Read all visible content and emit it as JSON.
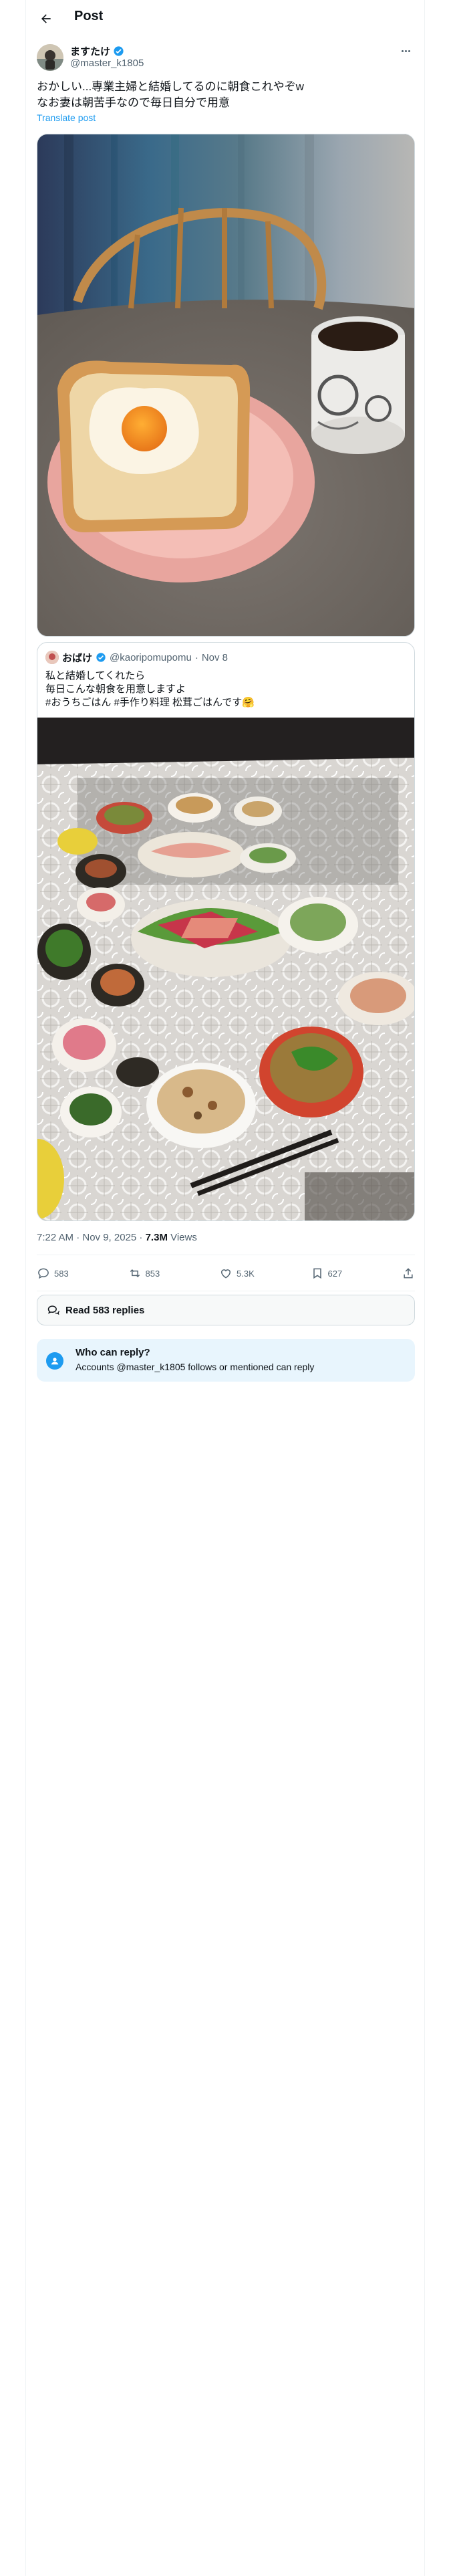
{
  "header": {
    "title": "Post",
    "back_icon": "arrow-left-icon"
  },
  "author": {
    "name": "ますたけ",
    "handle": "@master_k1805",
    "verified": true,
    "verified_color": "#1d9bf0"
  },
  "tweet": {
    "text": "おかしい...専業主婦と結婚してるのに朝食これやぞw\nなお妻は朝苦手なので毎日自分で用意",
    "translate_label": "Translate post"
  },
  "quote": {
    "name": "おばけ",
    "handle": "@kaoripomupomu",
    "separator": "·",
    "date": "Nov 8",
    "text": "私と結婚してくれたら\n毎日こんな朝食を用意しますよ\n#おうちごはん #手作り料理 松茸ごはんです🤗"
  },
  "meta": {
    "time": "7:22 AM · Nov 9, 2025 · ",
    "views_count": "7.3M",
    "views_label": " Views"
  },
  "actions": {
    "replies": "583",
    "reposts": "853",
    "likes": "5.3K",
    "bookmarks": "627"
  },
  "read_replies": {
    "label": "Read 583 replies"
  },
  "who_can_reply": {
    "title": "Who can reply?",
    "description": "Accounts @master_k1805 follows or mentioned can reply"
  },
  "colors": {
    "accent": "#1d9bf0",
    "text": "#0f1419",
    "muted": "#536471",
    "border": "#cfd9de"
  }
}
